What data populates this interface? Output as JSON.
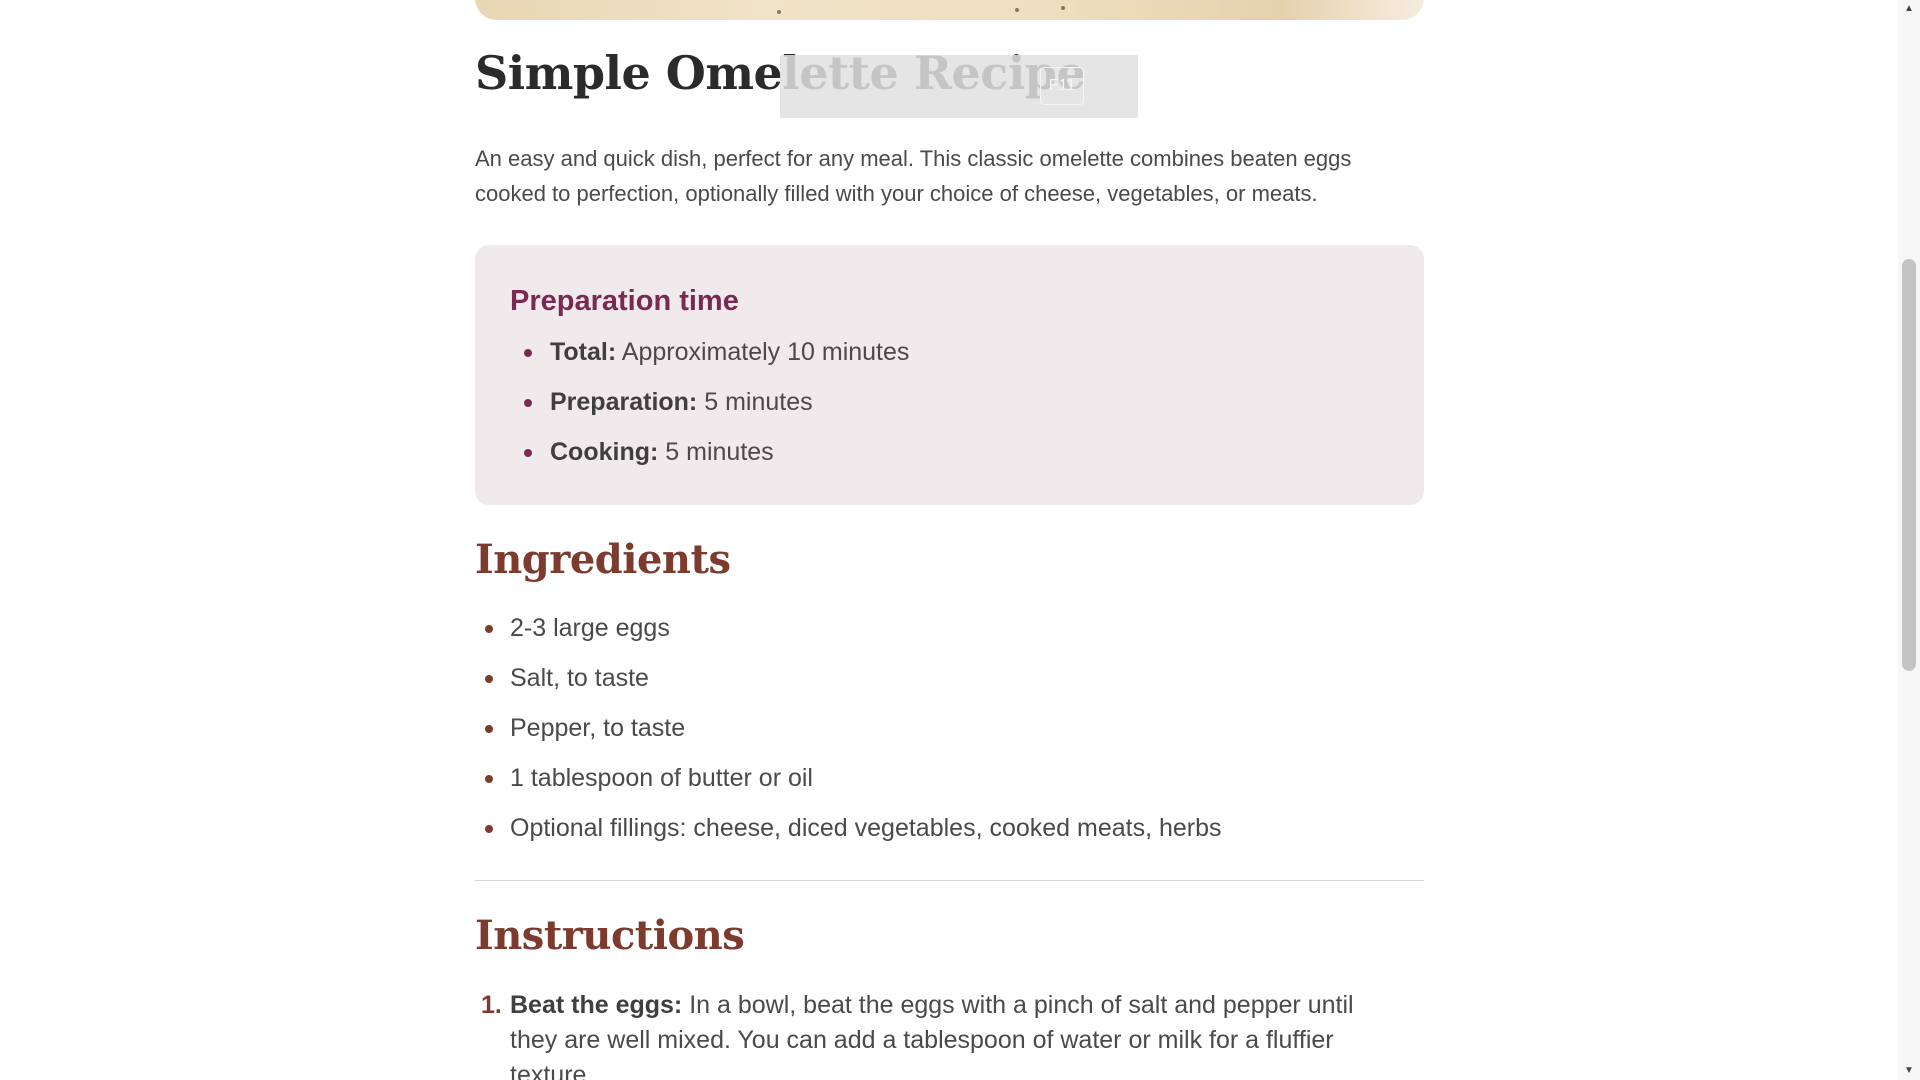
{
  "header": {
    "title": "Simple Omelette Recipe"
  },
  "fullscreen_hint": {
    "text": "ss",
    "key": "F11"
  },
  "intro": "An easy and quick dish, perfect for any meal. This classic omelette combines beaten eggs cooked to perfection, optionally filled with your choice of cheese, vegetables, or meats.",
  "prep": {
    "title": "Preparation time",
    "items": [
      {
        "label": "Total:",
        "value": "Approximately 10 minutes"
      },
      {
        "label": "Preparation:",
        "value": "5 minutes"
      },
      {
        "label": "Cooking:",
        "value": "5 minutes"
      }
    ]
  },
  "ingredients": {
    "title": "Ingredients",
    "items": [
      "2-3 large eggs",
      "Salt, to taste",
      "Pepper, to taste",
      "1 tablespoon of butter or oil",
      "Optional fillings: cheese, diced vegetables, cooked meats, herbs"
    ]
  },
  "instructions": {
    "title": "Instructions",
    "steps": [
      {
        "number": "1.",
        "label": "Beat the eggs:",
        "text": "In a bowl, beat the eggs with a pinch of salt and pepper until they are well mixed. You can add a tablespoon of water or milk for a fluffier texture."
      }
    ]
  },
  "colors": {
    "accent_plum": "#7a2a52",
    "accent_brown": "#7d3b2e",
    "prep_box_bg": "#f1eaec"
  },
  "icons": {
    "scroll_up": "chevron-up-icon",
    "scroll_down": "chevron-down-icon"
  }
}
